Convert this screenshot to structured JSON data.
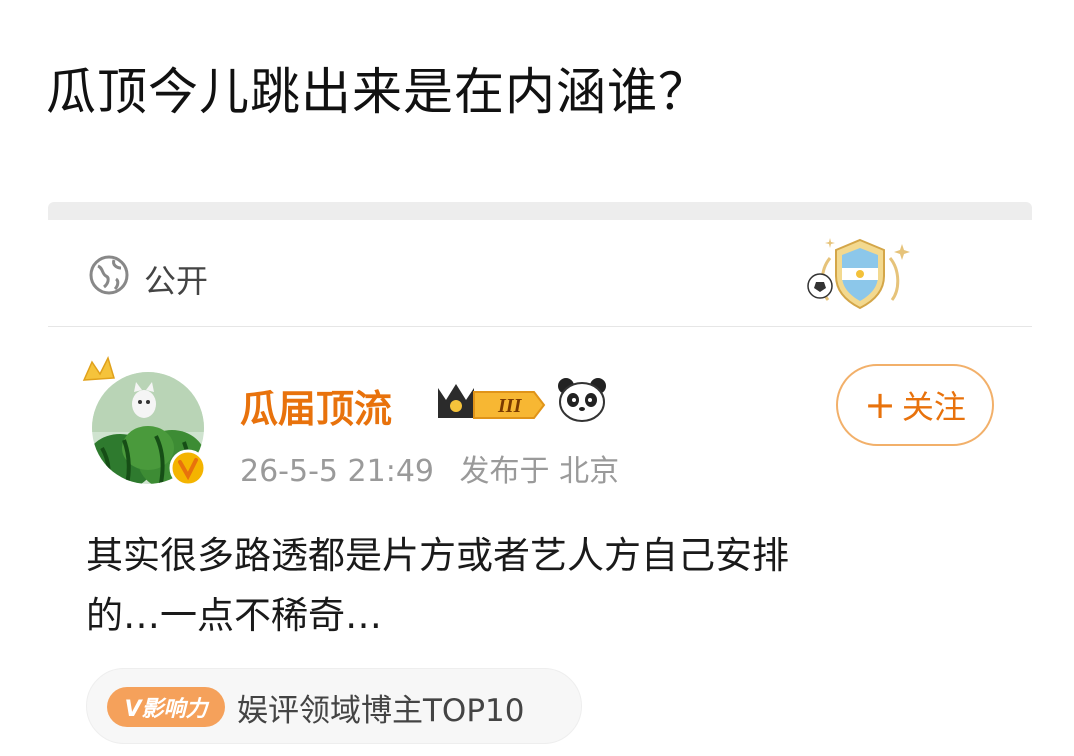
{
  "post": {
    "title": "瓜顶今儿跳出来是在内涵谁？",
    "visibility": "公开"
  },
  "author": {
    "name": "瓜届顶流",
    "level": "III",
    "timestamp": "26-5-5 21:49",
    "published_at": "发布于 北京",
    "follow_label": "关注",
    "follow_prefix": "+"
  },
  "content": {
    "line1": "其实很多路透都是片方或者艺人方自己安排",
    "line2": "的…一点不稀奇…"
  },
  "influence": {
    "tag": "V影响力",
    "label": "娱评领域博主TOP10"
  },
  "colors": {
    "accent": "#e8720c",
    "follow_border": "#f2b06a"
  },
  "icons": [
    "globe-icon",
    "argentina-shield-badge-icon",
    "crown-icon",
    "panda-icon",
    "verified-v-icon"
  ]
}
